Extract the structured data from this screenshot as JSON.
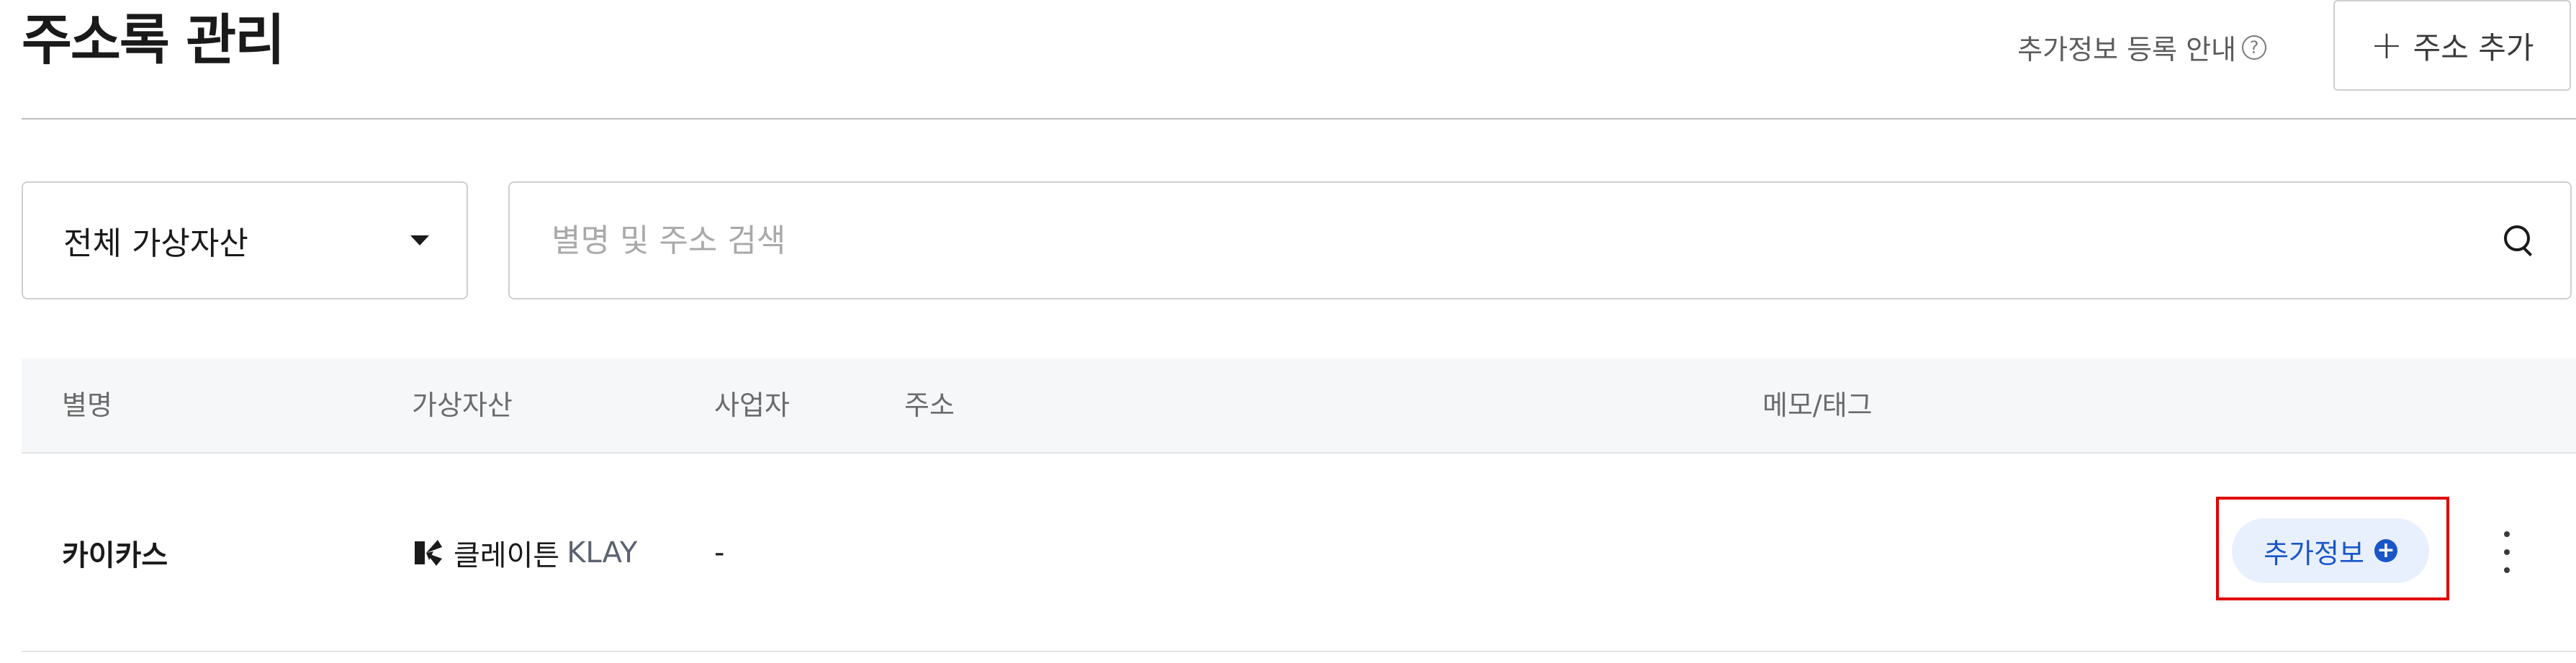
{
  "header": {
    "title": "주소록 관리",
    "guide_label": "추가정보 등록 안내",
    "help_icon": "question-circle-icon",
    "add_button_icon": "plus-icon",
    "add_button_label": "주소 추가"
  },
  "filters": {
    "asset_select_value": "전체 가상자산",
    "search_placeholder": "별명 및 주소 검색",
    "search_value": ""
  },
  "table": {
    "columns": [
      "별명",
      "가상자산",
      "사업자",
      "주소",
      "메모/태그"
    ],
    "rows": [
      {
        "alias": "카이카스",
        "asset_icon": "klaytn-icon",
        "asset_name": "클레이튼",
        "asset_symbol": "KLAY",
        "operator": "-",
        "address": "",
        "memo": "",
        "extra_info_label": "추가정보",
        "extra_info_icon": "plus-circle-icon",
        "more_icon": "more-vertical-icon"
      }
    ]
  },
  "colors": {
    "accent": "#1a56c8",
    "accent_bg": "#e8f0fd",
    "highlight": "#e00000",
    "table_header_bg": "#f6f7f9"
  }
}
